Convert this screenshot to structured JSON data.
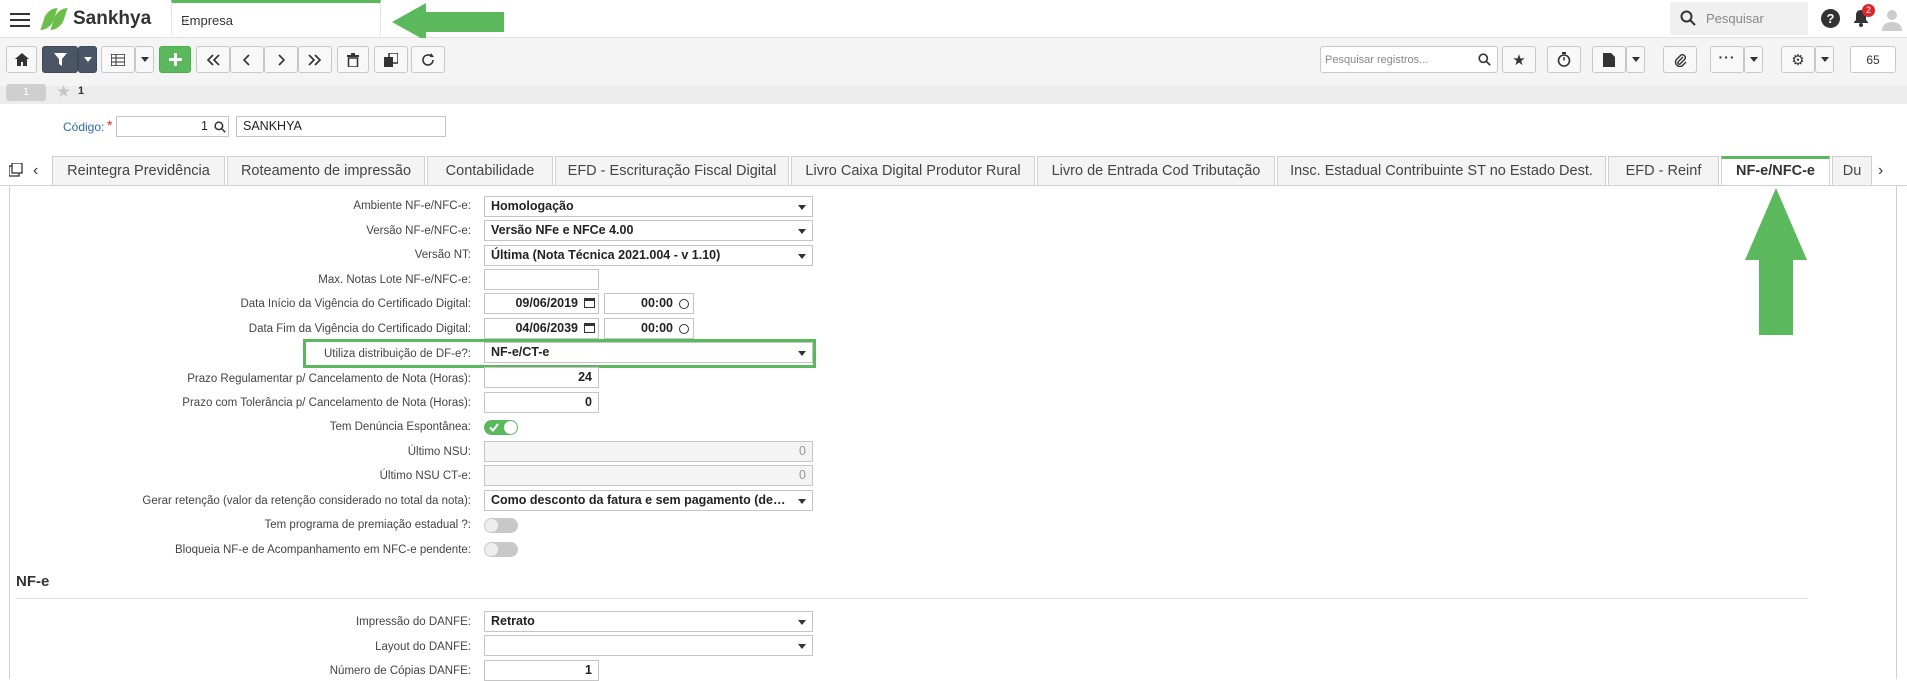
{
  "header": {
    "brand": "Sankhya",
    "open_tab": "Empresa",
    "close_glyph": "×",
    "search_placeholder": "Pesquisar",
    "help_glyph": "?",
    "notifications_count": "2",
    "accent": "#5cb85c"
  },
  "toolbar": {
    "search_records_placeholder": "Pesquisar registros...",
    "pager_value": "65",
    "icons": [
      "home-icon",
      "filter-icon",
      "grid-icon",
      "add-icon",
      "first-icon",
      "prev-icon",
      "next-icon",
      "last-icon",
      "delete-icon",
      "copy-icon",
      "refresh-icon",
      "search-icon",
      "star-icon",
      "timer-icon",
      "report-icon",
      "attach-icon",
      "more-icon",
      "gear-icon"
    ]
  },
  "record": {
    "pill": "1",
    "number": "1"
  },
  "codigo": {
    "label": "Código:",
    "required": "*",
    "value": "1",
    "description": "SANKHYA"
  },
  "tabs": [
    {
      "label": "Reintegra Previdência"
    },
    {
      "label": "Roteamento de impressão"
    },
    {
      "label": "Contabilidade"
    },
    {
      "label": "EFD - Escrituração Fiscal Digital"
    },
    {
      "label": "Livro Caixa Digital Produtor Rural"
    },
    {
      "label": "Livro de Entrada Cod Tributação"
    },
    {
      "label": "Insc. Estadual Contribuinte ST no Estado Dest."
    },
    {
      "label": "EFD - Reinf"
    },
    {
      "label": "NF-e/NFC-e"
    },
    {
      "label": "Du"
    }
  ],
  "form": {
    "ambiente": {
      "label": "Ambiente NF-e/NFC-e:",
      "value": "Homologação"
    },
    "versao": {
      "label": "Versão NF-e/NFC-e:",
      "value": "Versão NFe e NFCe 4.00"
    },
    "versao_nt": {
      "label": "Versão NT:",
      "value": "Última (Nota Técnica 2021.004 - v 1.10)"
    },
    "max_notas": {
      "label": "Max. Notas Lote NF-e/NFC-e:",
      "value": ""
    },
    "inicio_vig": {
      "label": "Data Início da Vigência do Certificado Digital:",
      "date": "09/06/2019",
      "time": "00:00"
    },
    "fim_vig": {
      "label": "Data Fim da Vigência do Certificado Digital:",
      "date": "04/06/2039",
      "time": "00:00"
    },
    "dist_dfe": {
      "label": "Utiliza distribuição de DF-e?:",
      "value": "NF-e/CT-e"
    },
    "prazo_reg": {
      "label": "Prazo Regulamentar p/ Cancelamento de Nota (Horas):",
      "value": "24"
    },
    "prazo_tol": {
      "label": "Prazo com Tolerância p/ Cancelamento de Nota (Horas):",
      "value": "0"
    },
    "denuncia": {
      "label": "Tem Denúncia Espontânea:",
      "on": true
    },
    "ultimo_nsu": {
      "label": "Último NSU:",
      "value": "0"
    },
    "ultimo_nsu_cte": {
      "label": "Último NSU CT-e:",
      "value": "0"
    },
    "gerar_ret": {
      "label": "Gerar retenção (valor da retenção considerado no total da nota):",
      "value": "Como desconto da fatura e sem pagamento (de…"
    },
    "premiacao": {
      "label": "Tem programa de premiação estadual ?:",
      "on": false
    },
    "bloqueia": {
      "label": "Bloqueia NF-e de Acompanhamento em NFC-e pendente:",
      "on": false
    }
  },
  "nfe_section": {
    "title": "NF-e",
    "impressao": {
      "label": "Impressão do DANFE:",
      "value": "Retrato"
    },
    "layout": {
      "label": "Layout do DANFE:",
      "value": ""
    },
    "copias": {
      "label": "Número de Cópias DANFE:",
      "value": "1"
    }
  }
}
